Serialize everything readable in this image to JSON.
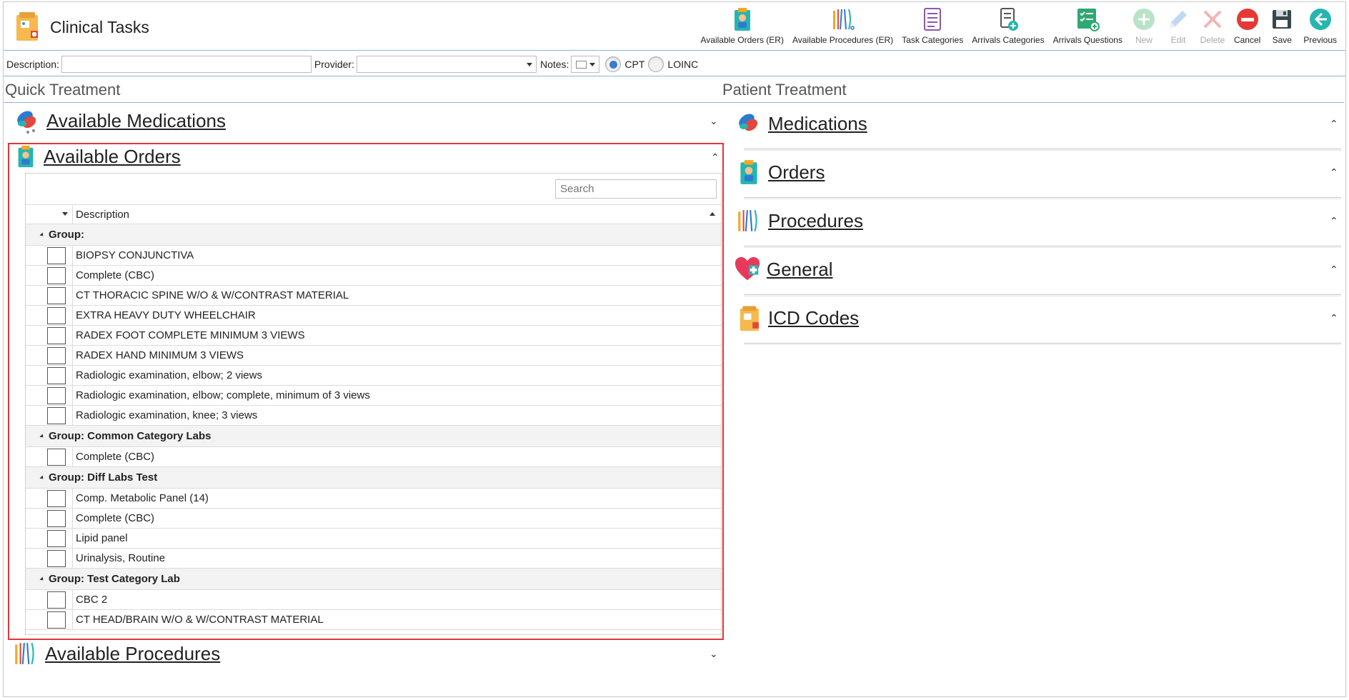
{
  "app": {
    "title": "Clinical Tasks"
  },
  "toolbar": [
    {
      "id": "available-orders-er",
      "label": "Available Orders (ER)",
      "enabled": true
    },
    {
      "id": "available-procedures-er",
      "label": "Available Procedures (ER)",
      "enabled": true
    },
    {
      "id": "task-categories",
      "label": "Task Categories",
      "enabled": true
    },
    {
      "id": "arrivals-categories",
      "label": "Arrivals Categories",
      "enabled": true
    },
    {
      "id": "arrivals-questions",
      "label": "Arrivals Questions",
      "enabled": true
    },
    {
      "id": "new",
      "label": "New",
      "enabled": false
    },
    {
      "id": "edit",
      "label": "Edit",
      "enabled": false
    },
    {
      "id": "delete",
      "label": "Delete",
      "enabled": false
    },
    {
      "id": "cancel",
      "label": "Cancel",
      "enabled": true
    },
    {
      "id": "save",
      "label": "Save",
      "enabled": true
    },
    {
      "id": "previous",
      "label": "Previous",
      "enabled": true
    }
  ],
  "filters": {
    "description_label": "Description:",
    "description_value": "",
    "provider_label": "Provider:",
    "provider_value": "",
    "notes_label": "Notes:",
    "code_options": [
      "CPT",
      "LOINC"
    ],
    "code_selected": "CPT"
  },
  "quick_treatment": {
    "title": "Quick Treatment",
    "sections": {
      "medications": "Available Medications",
      "orders": "Available Orders",
      "procedures": "Available Procedures"
    },
    "orders_grid": {
      "search_placeholder": "Search",
      "column_description": "Description",
      "groups": [
        {
          "label": "Group:",
          "items": [
            "BIOPSY CONJUNCTIVA",
            "Complete (CBC)",
            "CT THORACIC SPINE W/O & W/CONTRAST MATERIAL",
            "EXTRA HEAVY DUTY WHEELCHAIR",
            "RADEX FOOT COMPLETE MINIMUM 3 VIEWS",
            "RADEX HAND MINIMUM 3 VIEWS",
            "Radiologic examination, elbow; 2 views",
            "Radiologic examination, elbow; complete, minimum of 3 views",
            "Radiologic examination, knee; 3 views"
          ]
        },
        {
          "label": "Group: Common Category Labs",
          "items": [
            "Complete (CBC)"
          ]
        },
        {
          "label": "Group: Diff Labs Test",
          "items": [
            "Comp. Metabolic Panel (14)",
            "Complete (CBC)",
            "Lipid panel",
            "Urinalysis, Routine"
          ]
        },
        {
          "label": "Group: Test Category Lab",
          "items": [
            "CBC 2",
            "CT HEAD/BRAIN W/O & W/CONTRAST MATERIAL"
          ]
        }
      ]
    }
  },
  "patient_treatment": {
    "title": "Patient Treatment",
    "sections": {
      "medications": "Medications",
      "orders": "Orders",
      "procedures": "Procedures",
      "general": "General",
      "icd_codes": "ICD Codes"
    }
  },
  "icons": {
    "toolbar": [
      "clipboard-doctor-icon",
      "surgical-tools-icon",
      "list-document-icon",
      "document-plus-icon",
      "checklist-plus-icon",
      "plus-circle-icon",
      "pencil-icon",
      "x-icon",
      "minus-circle-icon",
      "floppy-disk-icon",
      "arrow-left-circle-icon"
    ]
  },
  "colors": {
    "accent_blue": "#3e7bd0",
    "highlight_border": "#e0373b",
    "cancel_red": "#e53935",
    "teal": "#26b5b0"
  }
}
